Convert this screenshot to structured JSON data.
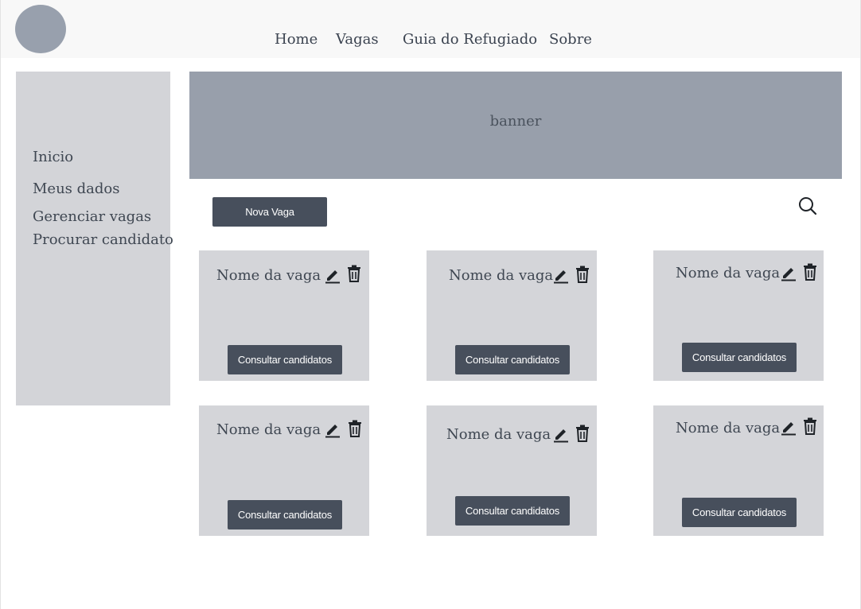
{
  "nav": {
    "items": [
      {
        "label": "Home"
      },
      {
        "label": "Vagas"
      },
      {
        "label": "Guia do Refugiado"
      },
      {
        "label": "Sobre"
      }
    ]
  },
  "sidebar": {
    "items": [
      {
        "label": "Inicio"
      },
      {
        "label": "Meus dados"
      },
      {
        "label": "Gerenciar vagas"
      },
      {
        "label": "Procurar candidato"
      }
    ]
  },
  "banner": {
    "label": "banner"
  },
  "toolbar": {
    "new_job_label": "Nova Vaga"
  },
  "icons": {
    "search": "search-icon",
    "edit": "pencil-icon",
    "delete": "trash-icon"
  },
  "cards": [
    {
      "title": "Nome da vaga",
      "button": "Consultar candidatos"
    },
    {
      "title": "Nome da vaga",
      "button": "Consultar candidatos"
    },
    {
      "title": "Nome da vaga",
      "button": "Consultar candidatos"
    },
    {
      "title": "Nome da vaga",
      "button": "Consultar candidatos"
    },
    {
      "title": "Nome da vaga",
      "button": "Consultar candidatos"
    },
    {
      "title": "Nome da vaga",
      "button": "Consultar candidatos"
    }
  ],
  "colors": {
    "topbar": "#f8f8f8",
    "logo": "#98a0ad",
    "sidebar": "#d3d4d8",
    "banner": "#989fab",
    "card": "#d4d5d9",
    "button": "#474f5c",
    "text": "#3f4752"
  }
}
